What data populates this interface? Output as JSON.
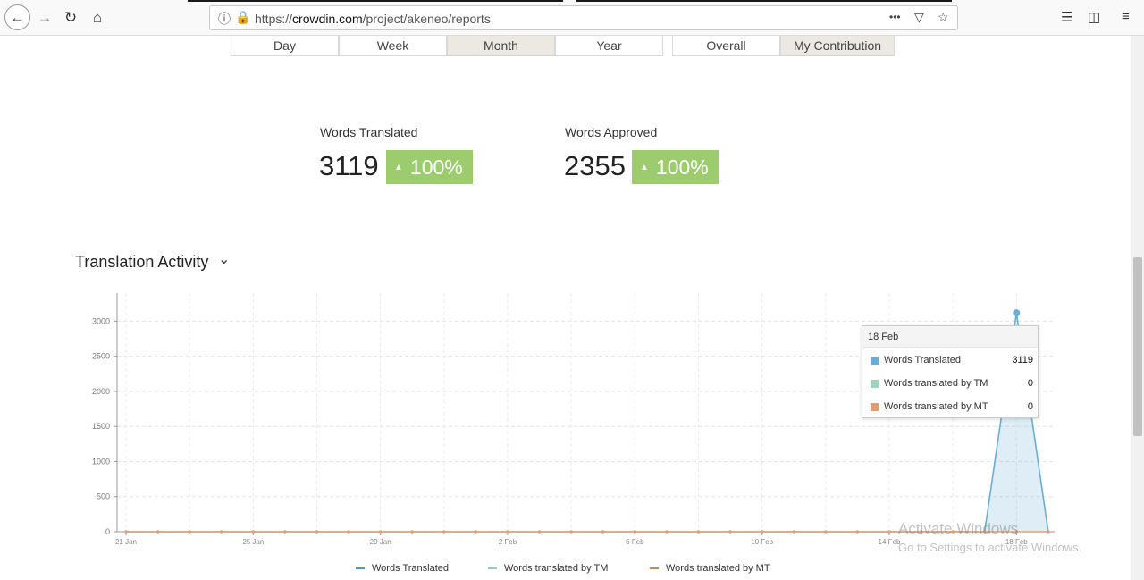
{
  "browser": {
    "url_prefix": "https://",
    "url_host": "crowdin.com",
    "url_path": "/project/akeneo/reports",
    "menu_dots": "•••"
  },
  "period_tabs": [
    {
      "label": "Day",
      "active": false
    },
    {
      "label": "Week",
      "active": false
    },
    {
      "label": "Month",
      "active": true
    },
    {
      "label": "Year",
      "active": false
    }
  ],
  "scope_tabs": [
    {
      "label": "Overall",
      "active": false
    },
    {
      "label": "My Contribution",
      "active": true
    }
  ],
  "stats": {
    "translated": {
      "label": "Words Translated",
      "value": "3119",
      "change": "100%"
    },
    "approved": {
      "label": "Words Approved",
      "value": "2355",
      "change": "100%"
    }
  },
  "section": {
    "title": "Translation Activity"
  },
  "chart_data": {
    "type": "area",
    "title": "",
    "xlabel": "",
    "ylabel": "",
    "ylim": [
      0,
      3400
    ],
    "yticks": [
      0,
      500,
      1000,
      1500,
      2000,
      2500,
      3000
    ],
    "x_tick_labels": [
      "21 Jan",
      "25 Jan",
      "29 Jan",
      "2 Feb",
      "6 Feb",
      "10 Feb",
      "14 Feb",
      "18 Feb"
    ],
    "x": [
      "21 Jan",
      "22 Jan",
      "23 Jan",
      "24 Jan",
      "25 Jan",
      "26 Jan",
      "27 Jan",
      "28 Jan",
      "29 Jan",
      "30 Jan",
      "31 Jan",
      "1 Feb",
      "2 Feb",
      "3 Feb",
      "4 Feb",
      "5 Feb",
      "6 Feb",
      "7 Feb",
      "8 Feb",
      "9 Feb",
      "10 Feb",
      "11 Feb",
      "12 Feb",
      "13 Feb",
      "14 Feb",
      "15 Feb",
      "16 Feb",
      "17 Feb",
      "18 Feb",
      "19 Feb"
    ],
    "grid": true,
    "legend": "bottom",
    "series": [
      {
        "name": "Words Translated",
        "color": "#6aaed6",
        "values": [
          0,
          0,
          0,
          0,
          0,
          0,
          0,
          0,
          0,
          0,
          0,
          0,
          0,
          0,
          0,
          0,
          0,
          0,
          0,
          0,
          0,
          0,
          0,
          0,
          0,
          0,
          0,
          0,
          3119,
          0
        ]
      },
      {
        "name": "Words translated by TM",
        "color": "#9fd4b8",
        "values": [
          0,
          0,
          0,
          0,
          0,
          0,
          0,
          0,
          0,
          0,
          0,
          0,
          0,
          0,
          0,
          0,
          0,
          0,
          0,
          0,
          0,
          0,
          0,
          0,
          0,
          0,
          0,
          0,
          0,
          0
        ]
      },
      {
        "name": "Words translated by MT",
        "color": "#e89a6a",
        "values": [
          0,
          0,
          0,
          0,
          0,
          0,
          0,
          0,
          0,
          0,
          0,
          0,
          0,
          0,
          0,
          0,
          0,
          0,
          0,
          0,
          0,
          0,
          0,
          0,
          0,
          0,
          0,
          0,
          0,
          0
        ]
      }
    ]
  },
  "tooltip": {
    "date": "18 Feb",
    "rows": [
      {
        "name": "Words Translated",
        "value": "3119",
        "color": "#6aaed6"
      },
      {
        "name": "Words translated by TM",
        "value": "0",
        "color": "#9fd4b8"
      },
      {
        "name": "Words translated by MT",
        "value": "0",
        "color": "#e89a6a"
      }
    ]
  },
  "legend": [
    {
      "name": "Words Translated",
      "color": "#4a9bc0"
    },
    {
      "name": "Words translated by TM",
      "color": "#9fc9c4"
    },
    {
      "name": "Words translated by MT",
      "color": "#c28a5b"
    }
  ],
  "watermark": {
    "line1": "Activate Windows",
    "line2": "Go to Settings to activate Windows."
  }
}
